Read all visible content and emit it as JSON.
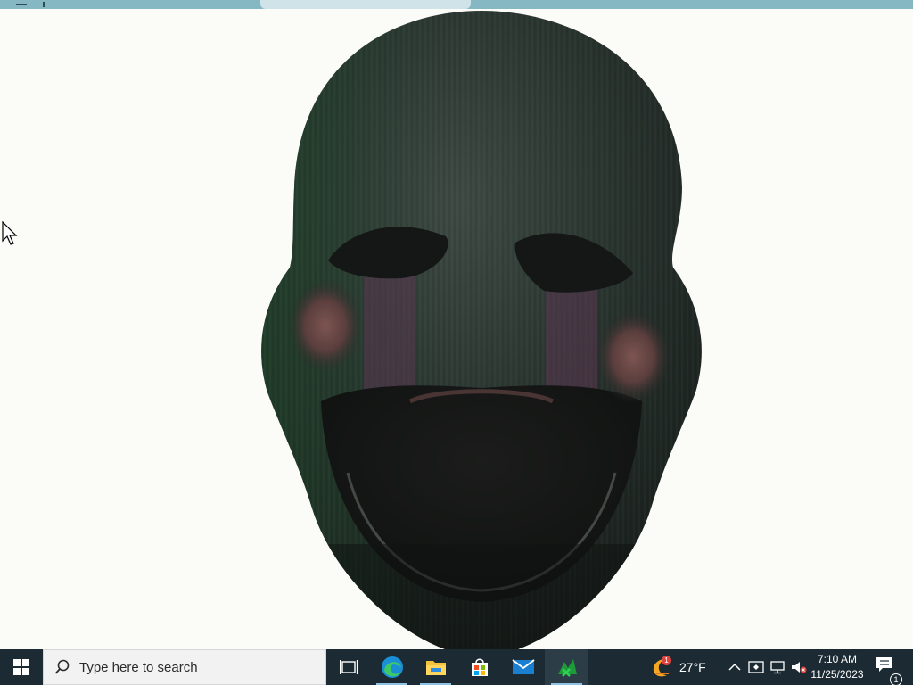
{
  "window": {
    "content": "3D mask model render"
  },
  "taskbar": {
    "search_placeholder": "Type here to search",
    "apps": [
      {
        "name": "Task View",
        "icon": "task-view-icon"
      },
      {
        "name": "Microsoft Edge",
        "icon": "edge-icon",
        "running": true
      },
      {
        "name": "File Explorer",
        "icon": "folder-icon",
        "running": true
      },
      {
        "name": "Microsoft Store",
        "icon": "store-icon"
      },
      {
        "name": "Mail",
        "icon": "mail-icon"
      },
      {
        "name": "Active app",
        "icon": "green-app-icon",
        "active": true
      }
    ],
    "weather": {
      "temperature": "27°F",
      "badge": "1",
      "icon": "weather-moon-icon"
    },
    "tray": {
      "icons": [
        "chevron-up-icon",
        "security-icon",
        "network-icon",
        "speaker-muted-icon"
      ]
    },
    "clock": {
      "time": "7:10 AM",
      "date": "11/25/2023"
    },
    "notifications": {
      "count": "1"
    }
  },
  "colors": {
    "taskbar_bg": "#1c2b33",
    "desktop_bg": "#fbfcf8",
    "accent": "#8fc1e3"
  }
}
